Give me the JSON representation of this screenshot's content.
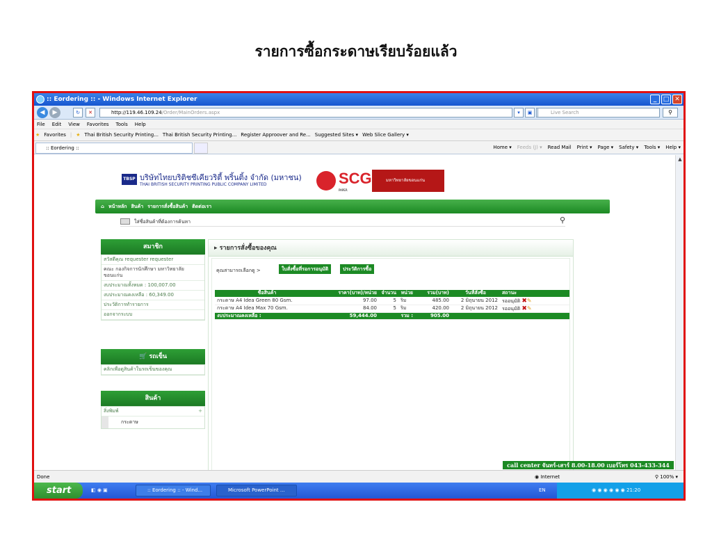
{
  "slide": {
    "title": "รายการซื้อกระดาษเรียบร้อยแล้ว"
  },
  "window": {
    "title": ":: Eordering :: - Windows Internet Explorer",
    "minimize": "_",
    "maximize": "□",
    "close": "✕"
  },
  "addressbar": {
    "url_host": "http://119.46.109.24",
    "url_path": "/Order/MainOrders.aspx",
    "search_placeholder": "Live Search"
  },
  "menubar": [
    "File",
    "Edit",
    "View",
    "Favorites",
    "Tools",
    "Help"
  ],
  "favorites": {
    "label": "Favorites",
    "items": [
      "Thai British Security Printing...",
      "Thai British Security Printing...",
      "Register Approover and Re...",
      "Suggested Sites ▾",
      "Web Slice Gallery ▾"
    ]
  },
  "tab": {
    "label": ":: Eordering ::"
  },
  "commandbar": {
    "home": "Home ▾",
    "feeds": "Feeds (J) ▾",
    "readmail": "Read Mail",
    "print": "Print ▾",
    "page": "Page ▾",
    "safety": "Safety ▾",
    "tools": "Tools ▾",
    "help": "Help ▾"
  },
  "header": {
    "logo_badge": "TBSP",
    "company_th": "บริษัทไทยบริติชซีเคียวริตี้ พริ้นติ้ง จำกัด (มหาชน)",
    "company_en": "THAI BRITISH SECURITY PRINTING PUBLIC COMPANY LIMITED",
    "scg": "SCG",
    "scg_sub": "PAPER",
    "kku": "มหาวิทยาลัยขอนแก่น"
  },
  "mainnav": [
    "หน้าหลัก",
    "สินค้า",
    "รายการสั่งซื้อสินค้า",
    "ติดต่อเรา"
  ],
  "search": {
    "placeholder": "ใส่ชื่อสินค้าที่ต้องการค้นหา"
  },
  "member": {
    "title": "สมาชิก",
    "items": [
      "สวัสดีคุณ requester requester",
      "คณะ กองกิจการนักศึกษา มหาวิทยาลัยขอนแก่น",
      "งบประมาณทั้งหมด : 100,007.00",
      "งบประมาณคงเหลือ : 60,349.00",
      "ประวัติการทำรายการ",
      "ออกจากระบบ"
    ]
  },
  "cart": {
    "title": "รถเข็น",
    "link": "คลิกเพื่อดูสินค้าในรถเข็นของคุณ"
  },
  "products": {
    "title": "สินค้า",
    "category": "สิ่งพิมพ์",
    "sub": "กระดาษ"
  },
  "panel": {
    "title": "รายการสั่งซื้อของคุณ",
    "crumb": "คุณสามารถเลือกดู >",
    "tab1": "ใบสั่งซื้อที่รอการอนุมัติ",
    "tab2": "ประวัติการซื้อ"
  },
  "orders": {
    "headers": [
      "ชื่อสินค้า",
      "ราคา(บาท)/หน่วย",
      "จำนวน",
      "หน่วย",
      "รวม(บาท)",
      "วันที่สั่งซื้อ",
      "สถานะ"
    ],
    "rows": [
      [
        "กระดาษ A4 Idea Green 80 Gsm.",
        "97.00",
        "5",
        "ริม",
        "485.00",
        "2 มิถุนายน 2012",
        "รออนุมัติ"
      ],
      [
        "กระดาษ A4 Idea Max 70 Gsm.",
        "84.00",
        "5",
        "ริม",
        "420.00",
        "2 มิถุนายน 2012",
        "รออนุมัติ"
      ]
    ],
    "remaining_label": "งบประมาณคงเหลือ :",
    "remaining_value": "59,444.00",
    "total_label": "รวม :",
    "total_value": "905.00"
  },
  "callcenter": "call center จันทร์-เสาร์ 8.00-18.00 เบอร์โทร 043-433-344",
  "status": {
    "left": "Done",
    "zone": "Internet",
    "zoom": "100%"
  },
  "taskbar": {
    "start": "start",
    "btn1": ":: Eordering :: - Wind...",
    "btn2": "Microsoft PowerPoint ...",
    "lang": "EN",
    "time": "21:20"
  },
  "colors": {
    "green": "#1c8a24",
    "frame_red": "#e01010",
    "xp_blue": "#2357d6"
  }
}
